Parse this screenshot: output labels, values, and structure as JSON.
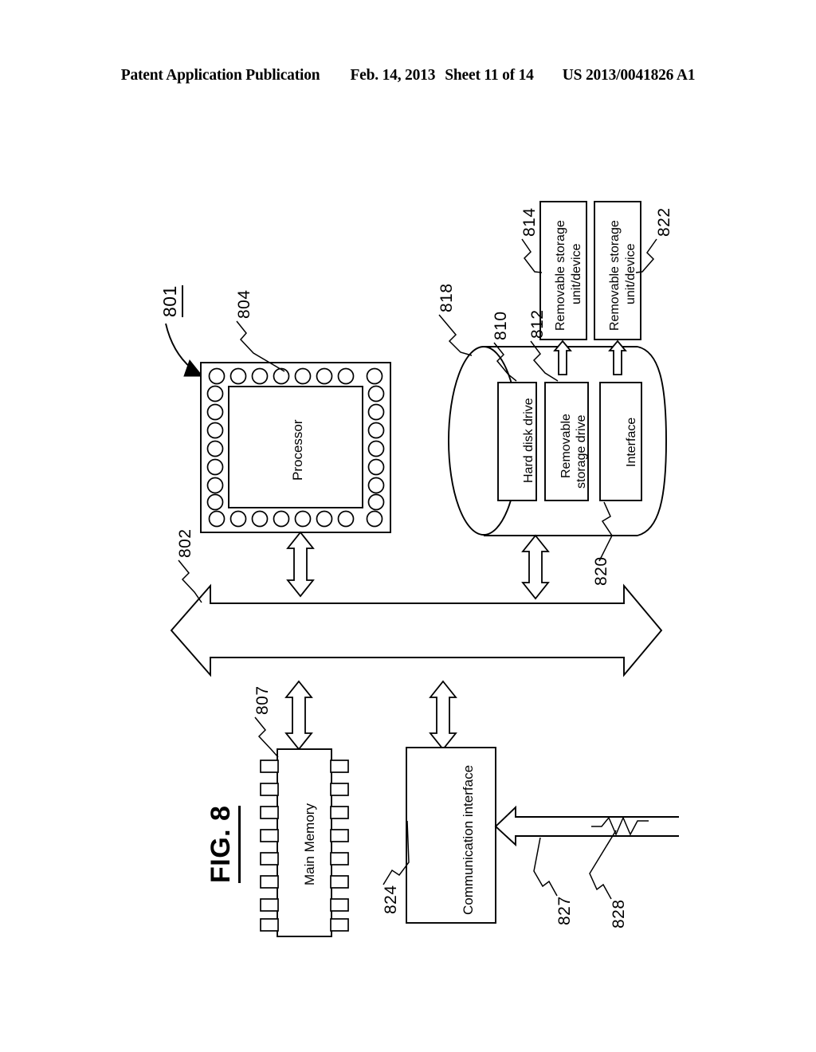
{
  "header": {
    "publication": "Patent Application Publication",
    "date": "Feb. 14, 2013",
    "sheet": "Sheet 11 of 14",
    "pub_number": "US 2013/0041826 A1"
  },
  "figure": {
    "title": "FIG. 8",
    "system_ref": "801"
  },
  "blocks": [
    {
      "id": "processor",
      "label": "Processor",
      "ref": "804"
    },
    {
      "id": "main-memory",
      "label": "Main Memory",
      "ref": "807"
    },
    {
      "id": "hard-disk-drive",
      "label": "Hard disk drive",
      "ref": "810"
    },
    {
      "id": "removable-storage-drive",
      "label": "Removable\nstorage drive",
      "ref": "812"
    },
    {
      "id": "interface",
      "label": "Interface",
      "ref": "820"
    },
    {
      "id": "removable-storage-unit-1",
      "label": "Removable storage\nunit/device",
      "ref": "814"
    },
    {
      "id": "removable-storage-unit-2",
      "label": "Removable storage\nunit/device",
      "ref": "822"
    },
    {
      "id": "communication-interface",
      "label": "Communication interface",
      "ref": "824"
    }
  ],
  "block_labels": {
    "processor": "Processor",
    "main_memory": "Main Memory",
    "hard_disk_drive": "Hard disk drive",
    "removable_storage_drive_l1": "Removable",
    "removable_storage_drive_l2": "storage drive",
    "interface": "Interface",
    "removable_storage_unit_1_l1": "Removable storage",
    "removable_storage_unit_1_l2": "unit/device",
    "removable_storage_unit_2_l1": "Removable storage",
    "removable_storage_unit_2_l2": "unit/device",
    "communication_interface": "Communication interface"
  },
  "reference_numerals": {
    "system": "801",
    "bus": "802",
    "processor": "804",
    "main_memory": "807",
    "hard_disk_drive": "810",
    "removable_storage_drive": "812",
    "removable_storage_unit_1": "814",
    "secondary_memory": "818",
    "interface": "820",
    "removable_storage_unit_2": "822",
    "communication_interface": "824",
    "communications_path": "827",
    "signals": "828"
  },
  "colors": {
    "ink": "#000000",
    "paper": "#ffffff"
  }
}
